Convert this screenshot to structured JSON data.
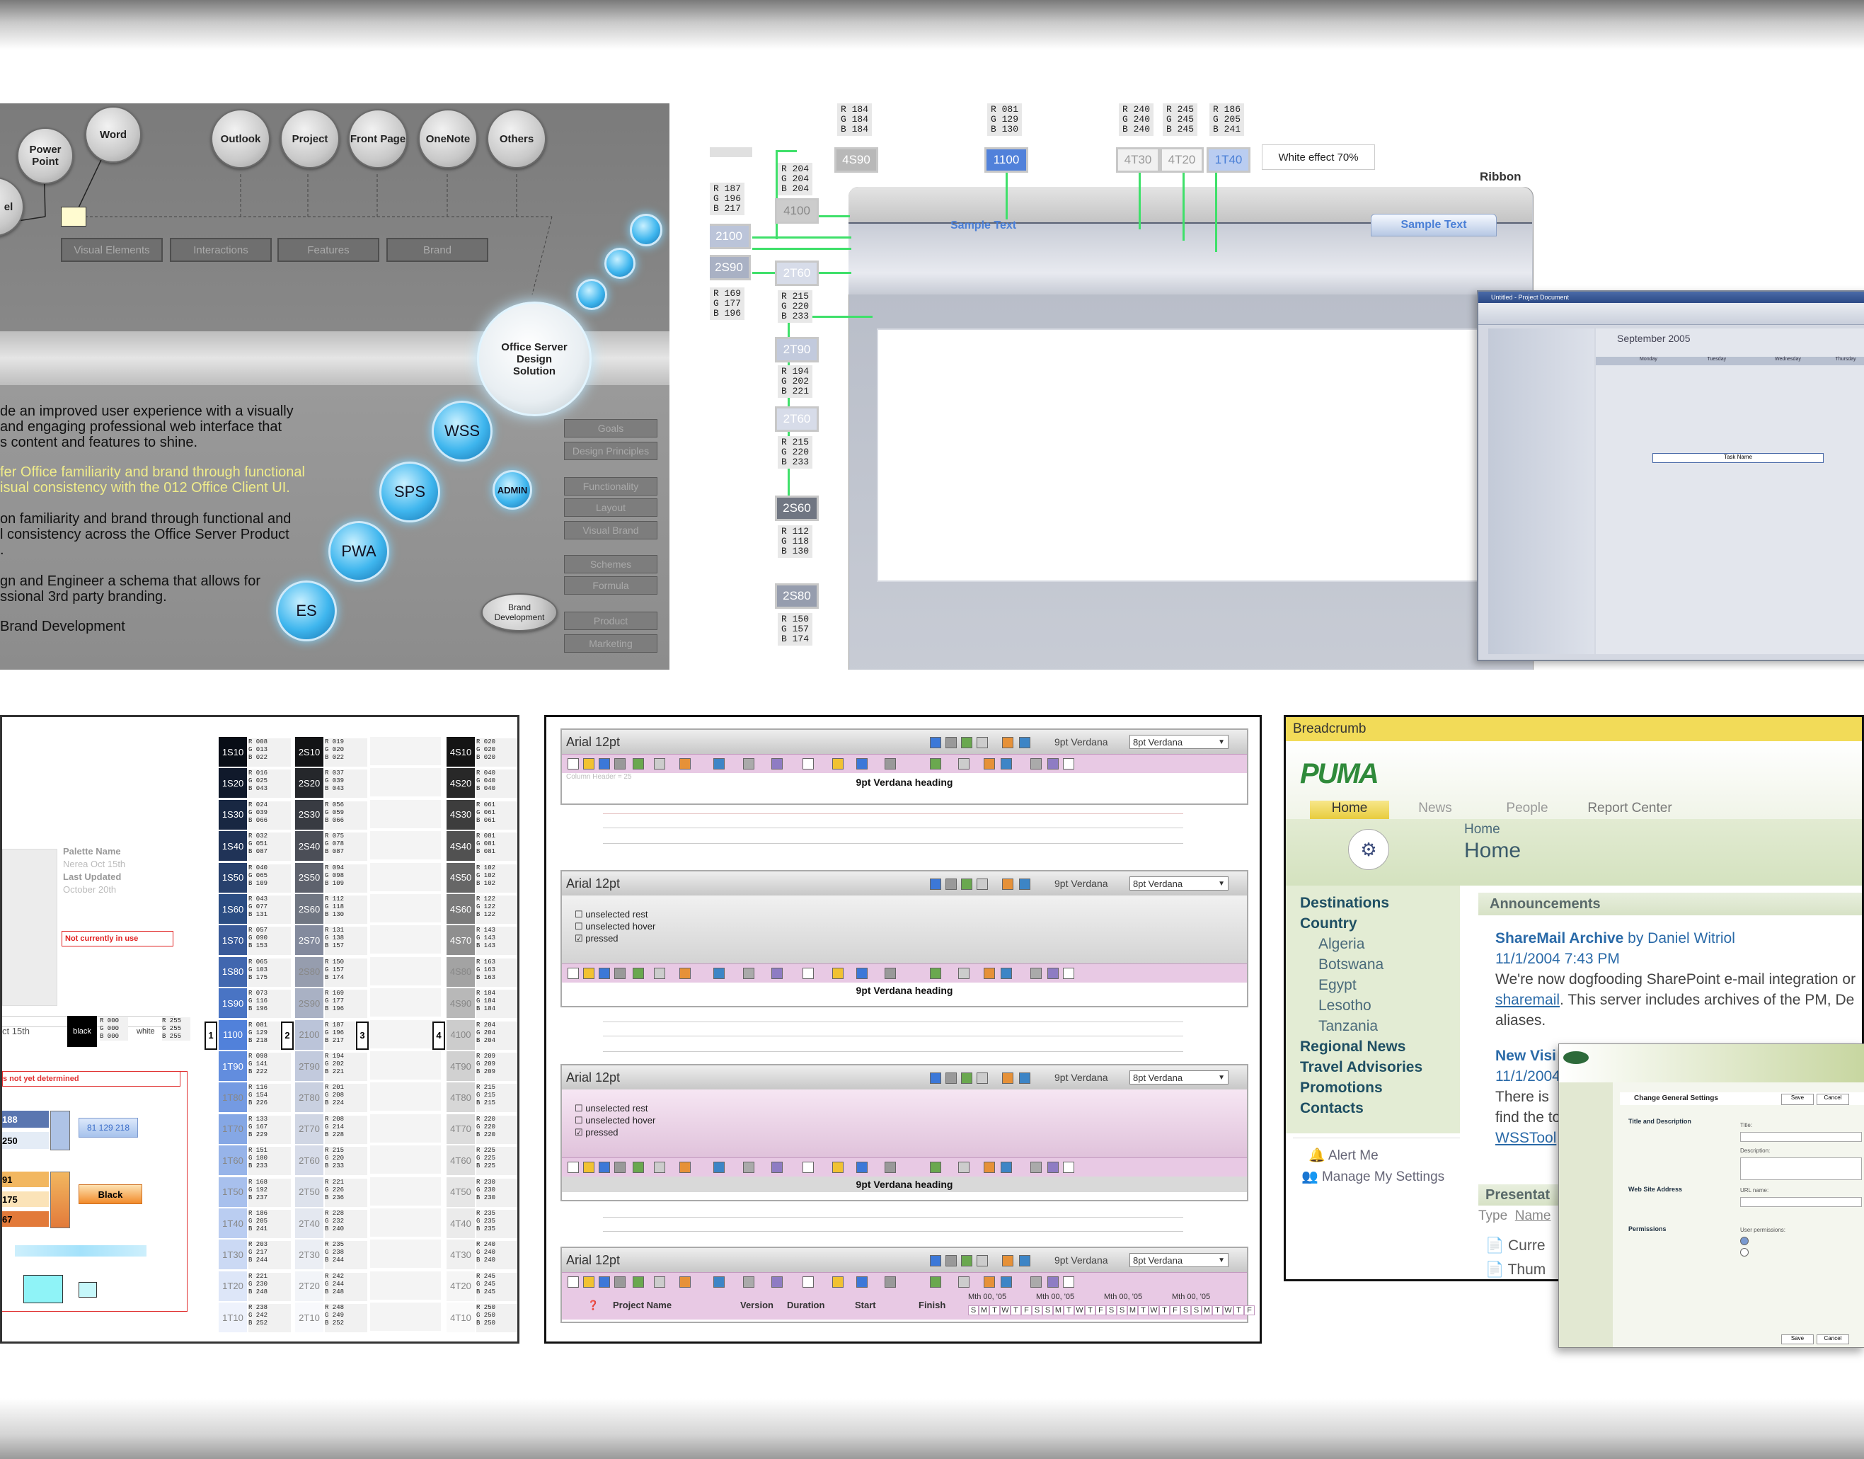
{
  "diagram": {
    "apps_left": [
      "el",
      "Power Point",
      "Word"
    ],
    "apps_top": [
      "Outlook",
      "Project",
      "Front Page",
      "OneNote",
      "Others"
    ],
    "tabs": [
      "Visual Elements",
      "Interactions",
      "Features",
      "Brand"
    ],
    "center": "Office Server Design Solution",
    "servers": [
      "WSS",
      "SPS",
      "PWA",
      "ES",
      "ADMIN"
    ],
    "brand_bubble": "Brand Development",
    "side_buttons": [
      "Goals",
      "Design Principles",
      "Functionality",
      "Layout",
      "Visual Brand",
      "Schemes",
      "Formula",
      "Product",
      "Marketing"
    ],
    "paragraphs": [
      {
        "lines": [
          "de an improved user experience with a visually",
          " and engaging professional web interface that",
          "s content and features to shine."
        ],
        "yellow": false
      },
      {
        "lines": [
          "fer Office familiarity and brand through functional",
          "isual consistency with the 012 Office Client UI."
        ],
        "yellow": true
      },
      {
        "lines": [
          "on familiarity and brand through functional and",
          "l consistency across the Office Server Product",
          "."
        ],
        "yellow": false
      },
      {
        "lines": [
          "gn and Engineer a schema that allows for",
          "ssional 3rd party branding."
        ],
        "yellow": false
      },
      {
        "lines": [
          " Brand Development"
        ],
        "yellow": false
      }
    ]
  },
  "ribbon": {
    "title": "Ribbon",
    "sample_left": "Sample Text",
    "sample_right": "Sample Text",
    "white_effect": "White effect 70%",
    "swatches_top": [
      {
        "code": "4S90",
        "rgb": "R 184\nG 184\nB 184"
      },
      {
        "code": "1100",
        "rgb": "R 081\nG 129\nB 130"
      },
      {
        "code": "4T30",
        "rgb": "R 240\nG 240\nB 240"
      },
      {
        "code": "4T20",
        "rgb": "R 245\nG 245\nB 245"
      },
      {
        "code": "1T40",
        "rgb": "R 186\nG 205\nB 241"
      }
    ],
    "swatches_left": [
      {
        "code": "2100",
        "rgb": "R 187\nG 196\nB 217"
      },
      {
        "code": "2S90",
        "rgb": "R 169\nG 177\nB 196"
      }
    ],
    "swatches_mid": [
      {
        "code": "4100",
        "rgb": "R 204\nG 204\nB 204"
      },
      {
        "code": "2T60",
        "rgb": "R 215\nG 220\nB 233"
      },
      {
        "code": "2T90",
        "rgb": "R 194\nG 202\nB 221"
      },
      {
        "code": "2T60",
        "rgb": "R 215\nG 220\nB 233"
      },
      {
        "code": "2S60",
        "rgb": "R 112\nG 118\nB 130"
      },
      {
        "code": "2S80",
        "rgb": "R 150\nG 157\nB 174"
      }
    ],
    "calendar": {
      "window_title": "Untitled - Project Document",
      "month": "September 2005",
      "task": "Task Name",
      "days": [
        "Monday",
        "Tuesday",
        "Wednesday",
        "Thursday"
      ]
    }
  },
  "palette": {
    "name_label": "Palette Name",
    "author": "Nerea Oct 15th",
    "updated_label": "Last Updated",
    "updated_value": "October 20th",
    "not_in_use": "Not currently in use",
    "not_determined": "s not yet determined",
    "date_fragment": "ct 15th",
    "black_label": "black",
    "black_rgb": "R 000\nG 000\nB 000",
    "white_label": "white",
    "white_rgb": "R 255\nG 255\nB 255",
    "black_swatch": "Black",
    "blue_chip": "81 129 218",
    "side_values": [
      "188",
      "250",
      "91",
      "175",
      "67"
    ],
    "col_numbers": [
      "1",
      "2",
      "3",
      "4"
    ],
    "col1": [
      {
        "c": "1S10",
        "v": "R 008\nG 013\nB 022"
      },
      {
        "c": "1S20",
        "v": "R 016\nG 025\nB 043"
      },
      {
        "c": "1S30",
        "v": "R 024\nG 039\nB 066"
      },
      {
        "c": "1S40",
        "v": "R 032\nG 051\nB 087"
      },
      {
        "c": "1S50",
        "v": "R 040\nG 065\nB 109"
      },
      {
        "c": "1S60",
        "v": "R 043\nG 077\nB 131"
      },
      {
        "c": "1S70",
        "v": "R 057\nG 090\nB 153"
      },
      {
        "c": "1S80",
        "v": "R 065\nG 103\nB 175"
      },
      {
        "c": "1S90",
        "v": "R 073\nG 116\nB 196"
      },
      {
        "c": "1100",
        "v": "R 081\nG 129\nB 218"
      },
      {
        "c": "1T90",
        "v": "R 098\nG 141\nB 222"
      },
      {
        "c": "1T80",
        "v": "R 116\nG 154\nB 226"
      },
      {
        "c": "1T70",
        "v": "R 133\nG 167\nB 229"
      },
      {
        "c": "1T60",
        "v": "R 151\nG 180\nB 233"
      },
      {
        "c": "1T50",
        "v": "R 168\nG 192\nB 237"
      },
      {
        "c": "1T40",
        "v": "R 186\nG 205\nB 241"
      },
      {
        "c": "1T30",
        "v": "R 203\nG 217\nB 244"
      },
      {
        "c": "1T20",
        "v": "R 221\nG 230\nB 248"
      },
      {
        "c": "1T10",
        "v": "R 238\nG 242\nB 252"
      }
    ],
    "col2": [
      {
        "c": "2S10",
        "v": "R 019\nG 020\nB 022"
      },
      {
        "c": "2S20",
        "v": "R 037\nG 039\nB 043"
      },
      {
        "c": "2S30",
        "v": "R 056\nG 059\nB 066"
      },
      {
        "c": "2S40",
        "v": "R 075\nG 078\nB 087"
      },
      {
        "c": "2S50",
        "v": "R 094\nG 098\nB 109"
      },
      {
        "c": "2S60",
        "v": "R 112\nG 118\nB 130"
      },
      {
        "c": "2S70",
        "v": "R 131\nG 138\nB 157"
      },
      {
        "c": "2S80",
        "v": "R 150\nG 157\nB 174"
      },
      {
        "c": "2S90",
        "v": "R 169\nG 177\nB 196"
      },
      {
        "c": "2100",
        "v": "R 187\nG 196\nB 217"
      },
      {
        "c": "2T90",
        "v": "R 194\nG 202\nB 221"
      },
      {
        "c": "2T80",
        "v": "R 201\nG 208\nB 224"
      },
      {
        "c": "2T70",
        "v": "R 208\nG 214\nB 228"
      },
      {
        "c": "2T60",
        "v": "R 215\nG 220\nB 233"
      },
      {
        "c": "2T50",
        "v": "R 221\nG 226\nB 236"
      },
      {
        "c": "2T40",
        "v": "R 228\nG 232\nB 240"
      },
      {
        "c": "2T30",
        "v": "R 235\nG 238\nB 244"
      },
      {
        "c": "2T20",
        "v": "R 242\nG 244\nB 248"
      },
      {
        "c": "2T10",
        "v": "R 248\nG 249\nB 252"
      }
    ],
    "col4": [
      {
        "c": "4S10",
        "v": "R 020\nG 020\nB 020"
      },
      {
        "c": "4S20",
        "v": "R 040\nG 040\nB 040"
      },
      {
        "c": "4S30",
        "v": "R 061\nG 061\nB 061"
      },
      {
        "c": "4S40",
        "v": "R 081\nG 081\nB 081"
      },
      {
        "c": "4S50",
        "v": "R 102\nG 102\nB 102"
      },
      {
        "c": "4S60",
        "v": "R 122\nG 122\nB 122"
      },
      {
        "c": "4S70",
        "v": "R 143\nG 143\nB 143"
      },
      {
        "c": "4S80",
        "v": "R 163\nG 163\nB 163"
      },
      {
        "c": "4S90",
        "v": "R 184\nG 184\nB 184"
      },
      {
        "c": "4100",
        "v": "R 204\nG 204\nB 204"
      },
      {
        "c": "4T90",
        "v": "R 209\nG 209\nB 209"
      },
      {
        "c": "4T80",
        "v": "R 215\nG 215\nB 215"
      },
      {
        "c": "4T70",
        "v": "R 220\nG 220\nB 220"
      },
      {
        "c": "4T60",
        "v": "R 225\nG 225\nB 225"
      },
      {
        "c": "4T50",
        "v": "R 230\nG 230\nB 230"
      },
      {
        "c": "4T40",
        "v": "R 235\nG 235\nB 235"
      },
      {
        "c": "4T30",
        "v": "R 240\nG 240\nB 240"
      },
      {
        "c": "4T20",
        "v": "R 245\nG 245\nB 245"
      },
      {
        "c": "4T10",
        "v": "R 250\nG 250\nB 250"
      }
    ]
  },
  "grid": {
    "title": "Arial 12pt",
    "font_size": "9pt Verdana",
    "select_value": "8pt Verdana",
    "heading": "9pt Verdana heading",
    "column_header": "Column Header = 25",
    "checkboxes": [
      "unselected rest",
      "unselected hover",
      "pressed"
    ],
    "columns": [
      "Project Name",
      "Version",
      "Duration",
      "Start",
      "Finish"
    ],
    "weeks": [
      "Mth 00, '05",
      "Mth 00, '05",
      "Mth 00, '05",
      "Mth 00, '05",
      "Mth 00, '05"
    ],
    "weekdays": [
      "S",
      "M",
      "T",
      "W",
      "T",
      "F",
      "S",
      "S",
      "M",
      "T",
      "W",
      "T",
      "F",
      "S",
      "S",
      "M",
      "T",
      "W",
      "T",
      "F",
      "S",
      "S",
      "M",
      "T",
      "W",
      "T",
      "F"
    ]
  },
  "portal": {
    "breadcrumb": "Breadcrumb",
    "logo": "PUMA",
    "tabs": [
      "Home",
      "News",
      "People",
      "Report Center"
    ],
    "crumb": "Home",
    "page_title": "Home",
    "nav": [
      {
        "t": "Destinations",
        "sub": false
      },
      {
        "t": "Country",
        "sub": false
      },
      {
        "t": "Algeria",
        "sub": true
      },
      {
        "t": "Botswana",
        "sub": true
      },
      {
        "t": "Egypt",
        "sub": true
      },
      {
        "t": "Lesotho",
        "sub": true
      },
      {
        "t": "Tanzania",
        "sub": true
      },
      {
        "t": "Regional News",
        "sub": false
      },
      {
        "t": "Travel Advisories",
        "sub": false
      },
      {
        "t": "Promotions",
        "sub": false
      },
      {
        "t": "Contacts",
        "sub": false
      }
    ],
    "alert": "Alert Me",
    "settings": "Manage My Settings",
    "announcements": "Announcements",
    "ann_title": "ShareMail Archive",
    "ann_by": "by Daniel Witriol",
    "ann_date": "11/1/2004 7:43 PM",
    "ann_body1": "We're now dogfooding SharePoint e-mail integration or",
    "ann_link": "sharemail",
    "ann_body2": ". This server includes archives of the PM, De",
    "ann_body3": "aliases.",
    "ann2_title": "New Visi",
    "ann2_date": "11/1/2004",
    "ann2_body1": "There is",
    "ann2_body2": "find the to",
    "ann2_link": "WSSTool",
    "presentations": "Presentat",
    "col_type": "Type",
    "col_name": "Name",
    "docs": [
      "Curre",
      "Thum"
    ],
    "settings_dialog": {
      "title": "Change General Settings",
      "ok": "Save",
      "cancel": "Cancel",
      "sections": [
        "Title and Description",
        "Web Site Address",
        "Permissions"
      ],
      "labels": [
        "Title:",
        "Description:",
        "URL name:",
        "User permissions:"
      ]
    }
  }
}
